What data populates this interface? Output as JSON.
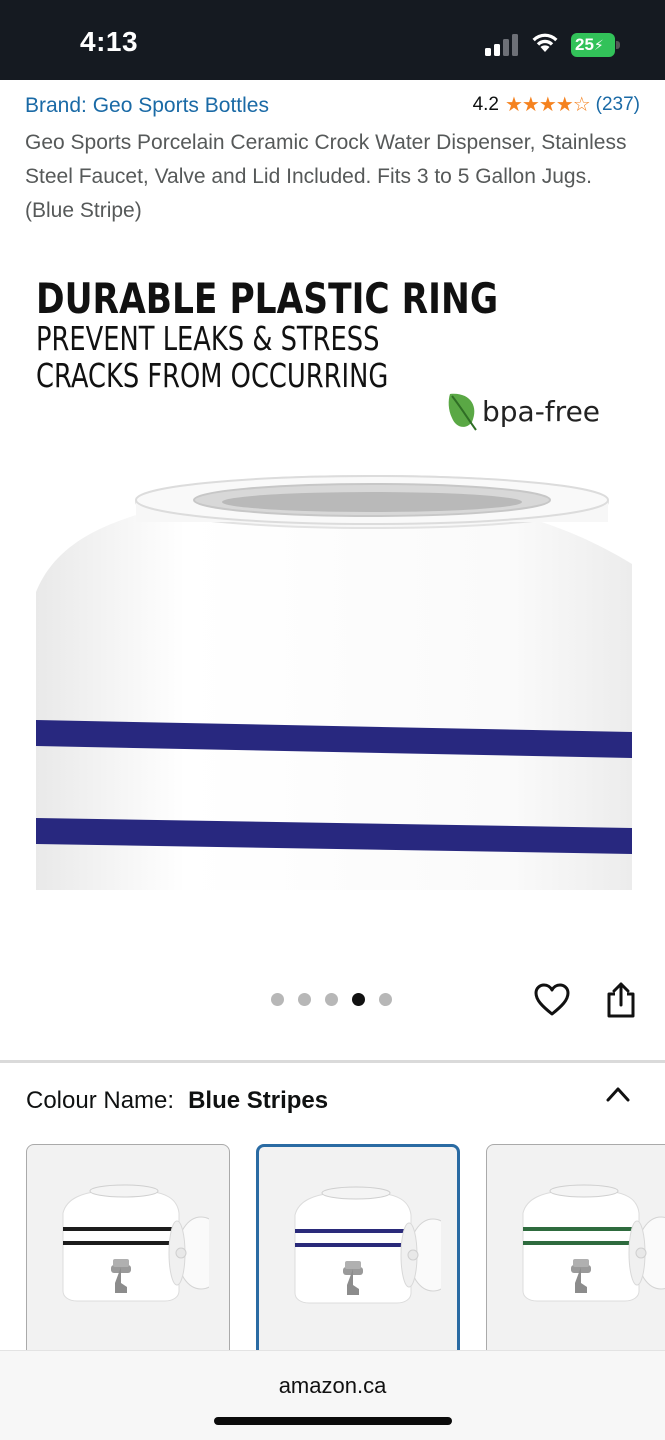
{
  "status_bar": {
    "time": "4:13",
    "battery": "25",
    "icons": [
      "signal-icon",
      "wifi-icon",
      "battery-charging-icon"
    ]
  },
  "product": {
    "brand": "Brand: Geo Sports Bottles",
    "rating": "4.2",
    "stars": "★★★★☆",
    "rating_count": "(237)",
    "title": "Geo Sports Porcelain Ceramic Crock Water Dispenser, Stainless Steel Faucet, Valve and Lid Included. Fits 3 to 5 Gallon Jugs. (Blue Stripe)"
  },
  "hero": {
    "headline": "DURABLE PLASTIC RING",
    "subline": "PREVENT LEAKS & STRESS CRACKS FROM OCCURRING",
    "badge": "bpa-free",
    "stripe_color": "#28287f",
    "carousel": {
      "count": 5,
      "active_index": 4
    }
  },
  "colour": {
    "label": "Colour Name:",
    "selected": "Blue Stripes",
    "swatches": [
      {
        "stripe_color": "#1c1c1c"
      },
      {
        "stripe_color": "#2a2a7a",
        "selected": true
      },
      {
        "stripe_color": "#2e6b3e"
      }
    ]
  },
  "browser": {
    "url": "amazon.ca"
  },
  "colors": {
    "link": "#1a6aa6",
    "star": "#f5821f",
    "selection_border": "#2a6ba3"
  }
}
